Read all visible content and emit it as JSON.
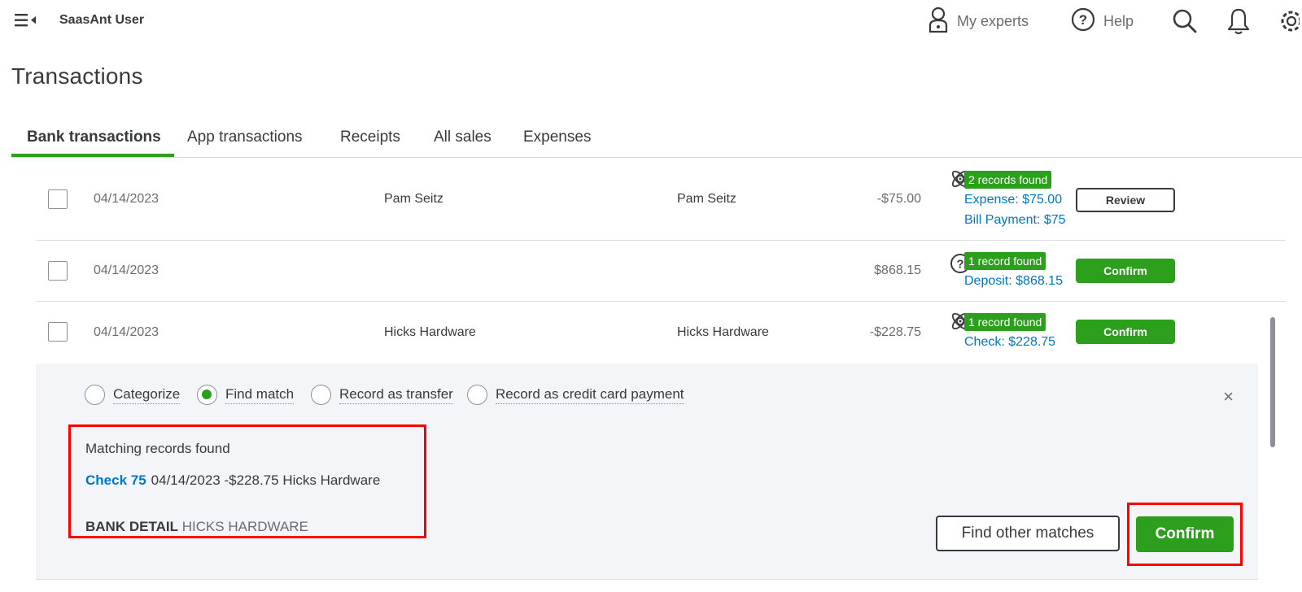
{
  "header": {
    "company_name": "SaasAnt User",
    "my_experts_label": "My experts",
    "help_label": "Help",
    "icons": [
      "menu-collapse-icon",
      "person-icon",
      "help-icon",
      "search-icon",
      "bell-icon",
      "gear-icon"
    ]
  },
  "page": {
    "title": "Transactions"
  },
  "tabs": [
    {
      "label": "Bank transactions",
      "active": true
    },
    {
      "label": "App transactions",
      "active": false
    },
    {
      "label": "Receipts",
      "active": false
    },
    {
      "label": "All sales",
      "active": false
    },
    {
      "label": "Expenses",
      "active": false
    }
  ],
  "rows": [
    {
      "date": "04/14/2023",
      "payee": "Pam Seitz",
      "description": "Pam Seitz",
      "amount": "-$75.00",
      "match_icon": "atom-icon",
      "badge": "2 records found",
      "links": [
        "Expense: $75.00",
        "Bill Payment: $75.00"
      ],
      "action": "Review"
    },
    {
      "date": "04/14/2023",
      "payee": "",
      "description": "",
      "amount": "$868.15",
      "match_icon": "question-circle-icon",
      "badge": "1 record found",
      "links": [
        "Deposit: $868.15"
      ],
      "action": "Confirm"
    },
    {
      "date": "04/14/2023",
      "payee": "Hicks Hardware",
      "description": "Hicks Hardware",
      "amount": "-$228.75",
      "match_icon": "atom-icon",
      "badge": "1 record found",
      "links": [
        "Check: $228.75"
      ],
      "action": "Confirm"
    }
  ],
  "panel": {
    "options": [
      {
        "label": "Categorize",
        "selected": false
      },
      {
        "label": "Find match",
        "selected": true
      },
      {
        "label": "Record as transfer",
        "selected": false
      },
      {
        "label": "Record as credit card payment",
        "selected": false
      }
    ],
    "close_label": "×",
    "matching_title": "Matching records found",
    "match_link": "Check 75",
    "match_details": "04/14/2023 -$228.75 Hicks Hardware",
    "bank_detail_label": "BANK DETAIL",
    "bank_detail_value": "HICKS HARDWARE",
    "find_other_label": "Find other matches",
    "confirm_label": "Confirm"
  },
  "colors": {
    "accent_green": "#2ca01c",
    "link_blue": "#0077c5",
    "highlight_red": "#ff0000",
    "text_dark": "#393a3d"
  }
}
